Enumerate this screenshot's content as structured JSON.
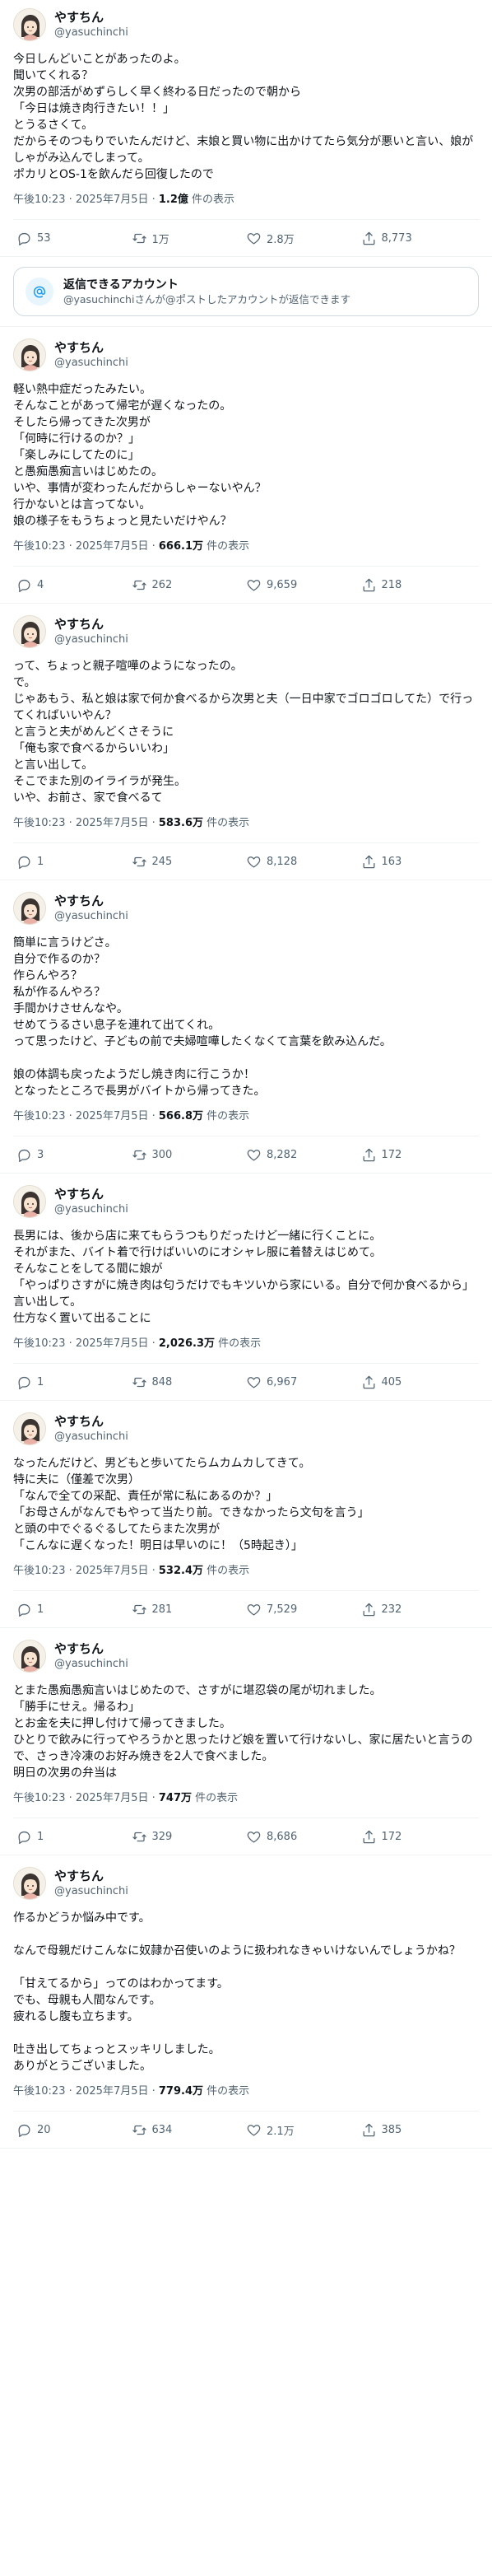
{
  "author": {
    "display_name": "やすちん",
    "handle": "@yasuchinchi"
  },
  "notice": {
    "title": "返信できるアカウント",
    "desc": "@yasuchinchiさんが@ポストしたアカウントが返信できます",
    "icon": "at-icon"
  },
  "colors": {
    "accent": "#1d9bf0",
    "muted": "#536471",
    "text": "#0f1419",
    "border": "#eff3f4"
  },
  "tweets": [
    {
      "text": "今日しんどいことがあったのよ。\n聞いてくれる？\n次男の部活がめずらしく早く終わる日だったので朝から\n「今日は焼き肉行きたい！！」\nとうるさくて。\nだからそのつもりでいたんだけど、末娘と買い物に出かけてたら気分が悪いと言い、娘がしゃがみ込んでしまって。\nポカリとOS-1を飲んだら回復したので",
      "time": "午後10:23 · 2025年7月5日 · ",
      "views": "1.2億",
      "views_suffix": " 件の表示",
      "stats": {
        "reply": "53",
        "repost": "1万",
        "like": "2.8万",
        "bookmark": "8,773"
      }
    },
    {
      "text": "軽い熱中症だったみたい。\nそんなことがあって帰宅が遅くなったの。\nそしたら帰ってきた次男が\n「何時に行けるのか？」\n「楽しみにしてたのに」\nと愚痴愚痴言いはじめたの。\nいや、事情が変わったんだからしゃーないやん？\n行かないとは言ってない。\n娘の様子をもうちょっと見たいだけやん？",
      "time": "午後10:23 · 2025年7月5日 · ",
      "views": "666.1万",
      "views_suffix": " 件の表示",
      "stats": {
        "reply": "4",
        "repost": "262",
        "like": "9,659",
        "bookmark": "218"
      }
    },
    {
      "text": "って、ちょっと親子喧嘩のようになったの。\nで。\nじゃあもう、私と娘は家で何か食べるから次男と夫（一日中家でゴロゴロしてた）で行ってくればいいやん？\nと言うと夫がめんどくさそうに\n「俺も家で食べるからいいわ」\nと言い出して。\nそこでまた別のイライラが発生。\nいや、お前さ、家で食べるて",
      "time": "午後10:23 · 2025年7月5日 · ",
      "views": "583.6万",
      "views_suffix": " 件の表示",
      "stats": {
        "reply": "1",
        "repost": "245",
        "like": "8,128",
        "bookmark": "163"
      }
    },
    {
      "text": "簡単に言うけどさ。\n自分で作るのか？\n作らんやろ？\n私が作るんやろ？\n手間かけさせんなや。\nせめてうるさい息子を連れて出てくれ。\nって思ったけど、子どもの前で夫婦喧嘩したくなくて言葉を飲み込んだ。\n\n娘の体調も戻ったようだし焼き肉に行こうか！\nとなったところで長男がバイトから帰ってきた。",
      "time": "午後10:23 · 2025年7月5日 · ",
      "views": "566.8万",
      "views_suffix": " 件の表示",
      "stats": {
        "reply": "3",
        "repost": "300",
        "like": "8,282",
        "bookmark": "172"
      }
    },
    {
      "text": "長男には、後から店に来てもらうつもりだったけど一緒に行くことに。\nそれがまた、バイト着で行けばいいのにオシャレ服に着替えはじめて。\nそんなことをしてる間に娘が\n「やっぱりさすがに焼き肉は匂うだけでもキツいから家にいる。自分で何か食べるから」\n言い出して。\n仕方なく置いて出ることに",
      "time": "午後10:23 · 2025年7月5日 · ",
      "views": "2,026.3万",
      "views_suffix": " 件の表示",
      "stats": {
        "reply": "1",
        "repost": "848",
        "like": "6,967",
        "bookmark": "405"
      }
    },
    {
      "text": "なったんだけど、男どもと歩いてたらムカムカしてきて。\n特に夫に（僅差で次男）\n「なんで全ての采配、責任が常に私にあるのか？」\n「お母さんがなんでもやって当たり前。できなかったら文句を言う」\nと頭の中でぐるぐるしてたらまた次男が\n「こんなに遅くなった！明日は早いのに！（5時起き）」",
      "time": "午後10:23 · 2025年7月5日 · ",
      "views": "532.4万",
      "views_suffix": " 件の表示",
      "stats": {
        "reply": "1",
        "repost": "281",
        "like": "7,529",
        "bookmark": "232"
      }
    },
    {
      "text": "とまた愚痴愚痴言いはじめたので、さすがに堪忍袋の尾が切れました。\n「勝手にせえ。帰るわ」\nとお金を夫に押し付けて帰ってきました。\nひとりで飲みに行ってやろうかと思ったけど娘を置いて行けないし、家に居たいと言うので、さっき冷凍のお好み焼きを2人で食べました。\n明日の次男の弁当は",
      "time": "午後10:23 · 2025年7月5日 · ",
      "views": "747万",
      "views_suffix": " 件の表示",
      "stats": {
        "reply": "1",
        "repost": "329",
        "like": "8,686",
        "bookmark": "172"
      }
    },
    {
      "text": "作るかどうか悩み中です。\n\nなんで母親だけこんなに奴隷か召使いのように扱われなきゃいけないんでしょうかね？\n\n「甘えてるから」ってのはわかってます。\nでも、母親も人間なんです。\n疲れるし腹も立ちます。\n\n吐き出してちょっとスッキリしました。\nありがとうございました。",
      "time": "午後10:23 · 2025年7月5日 · ",
      "views": "779.4万",
      "views_suffix": " 件の表示",
      "stats": {
        "reply": "20",
        "repost": "634",
        "like": "2.1万",
        "bookmark": "385"
      }
    }
  ]
}
